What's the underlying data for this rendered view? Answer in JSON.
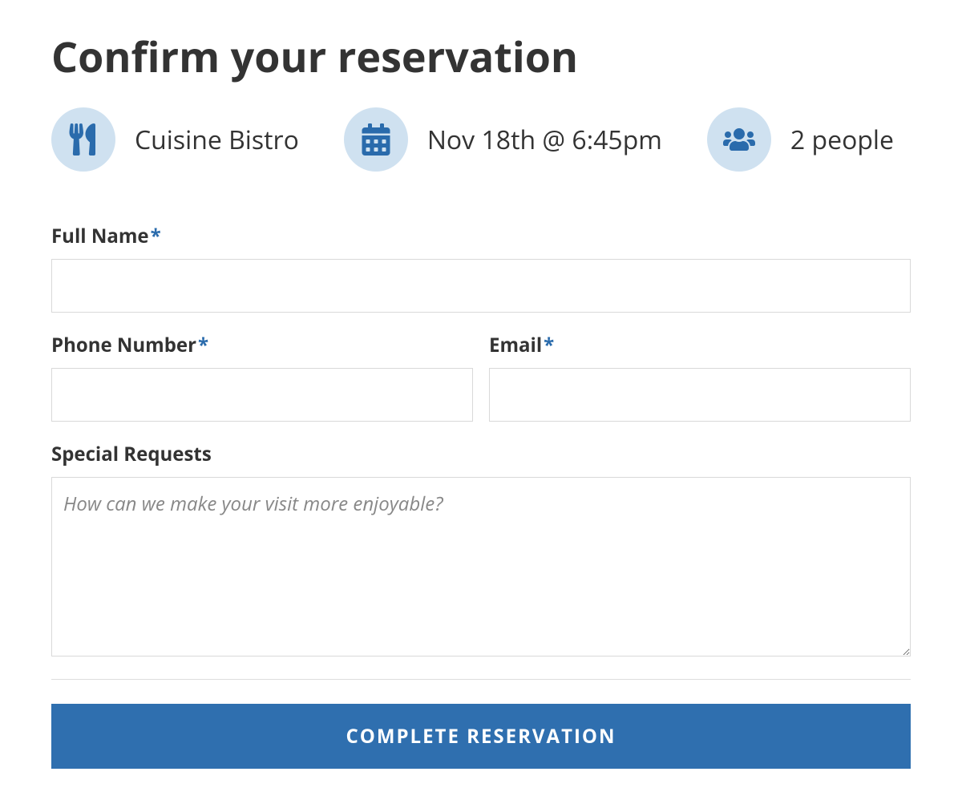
{
  "page_title": "Confirm your reservation",
  "summary": {
    "restaurant": "Cuisine Bistro",
    "datetime": "Nov 18th @ 6:45pm",
    "party": "2 people"
  },
  "form": {
    "full_name": {
      "label": "Full Name",
      "required_marker": "*",
      "value": ""
    },
    "phone": {
      "label": "Phone Number",
      "required_marker": "*",
      "value": ""
    },
    "email": {
      "label": "Email",
      "required_marker": "*",
      "value": ""
    },
    "special_requests": {
      "label": "Special Requests",
      "placeholder": "How can we make your visit more enjoyable?",
      "value": ""
    },
    "submit_label": "COMPLETE RESERVATION"
  }
}
